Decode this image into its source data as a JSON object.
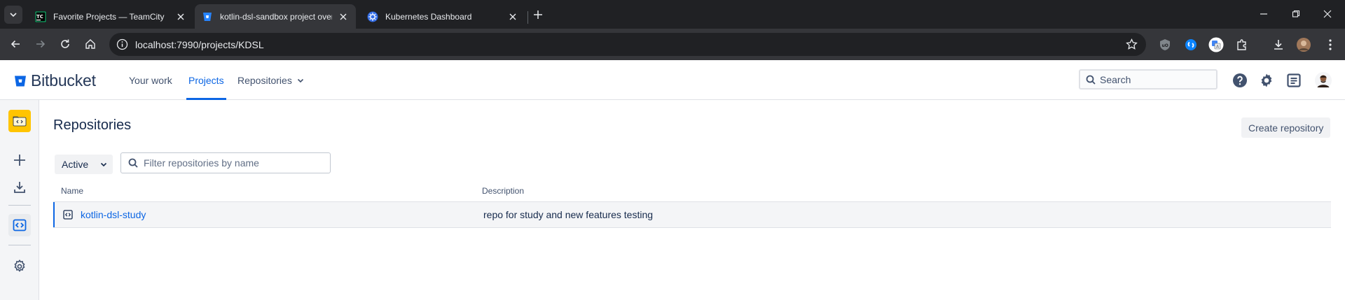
{
  "browser": {
    "tabs": [
      {
        "title": "Favorite Projects — TeamCity",
        "active": false
      },
      {
        "title": "kotlin-dsl-sandbox project over",
        "active": true
      },
      {
        "title": "Kubernetes Dashboard",
        "active": false
      }
    ],
    "url": "localhost:7990/projects/KDSL"
  },
  "header": {
    "logo": "Bitbucket",
    "nav": [
      {
        "label": "Your work"
      },
      {
        "label": "Projects"
      },
      {
        "label": "Repositories"
      }
    ],
    "search_placeholder": "Search"
  },
  "main": {
    "title": "Repositories",
    "create_button": "Create repository",
    "status_filter": "Active",
    "filter_placeholder": "Filter repositories by name",
    "columns": [
      "Name",
      "Description"
    ],
    "rows": [
      {
        "name": "kotlin-dsl-study",
        "description": "repo for study and new features testing"
      }
    ]
  },
  "colors": {
    "accent": "#0c66e4",
    "browser_dark": "#202124",
    "project_avatar": "#ffc400"
  }
}
